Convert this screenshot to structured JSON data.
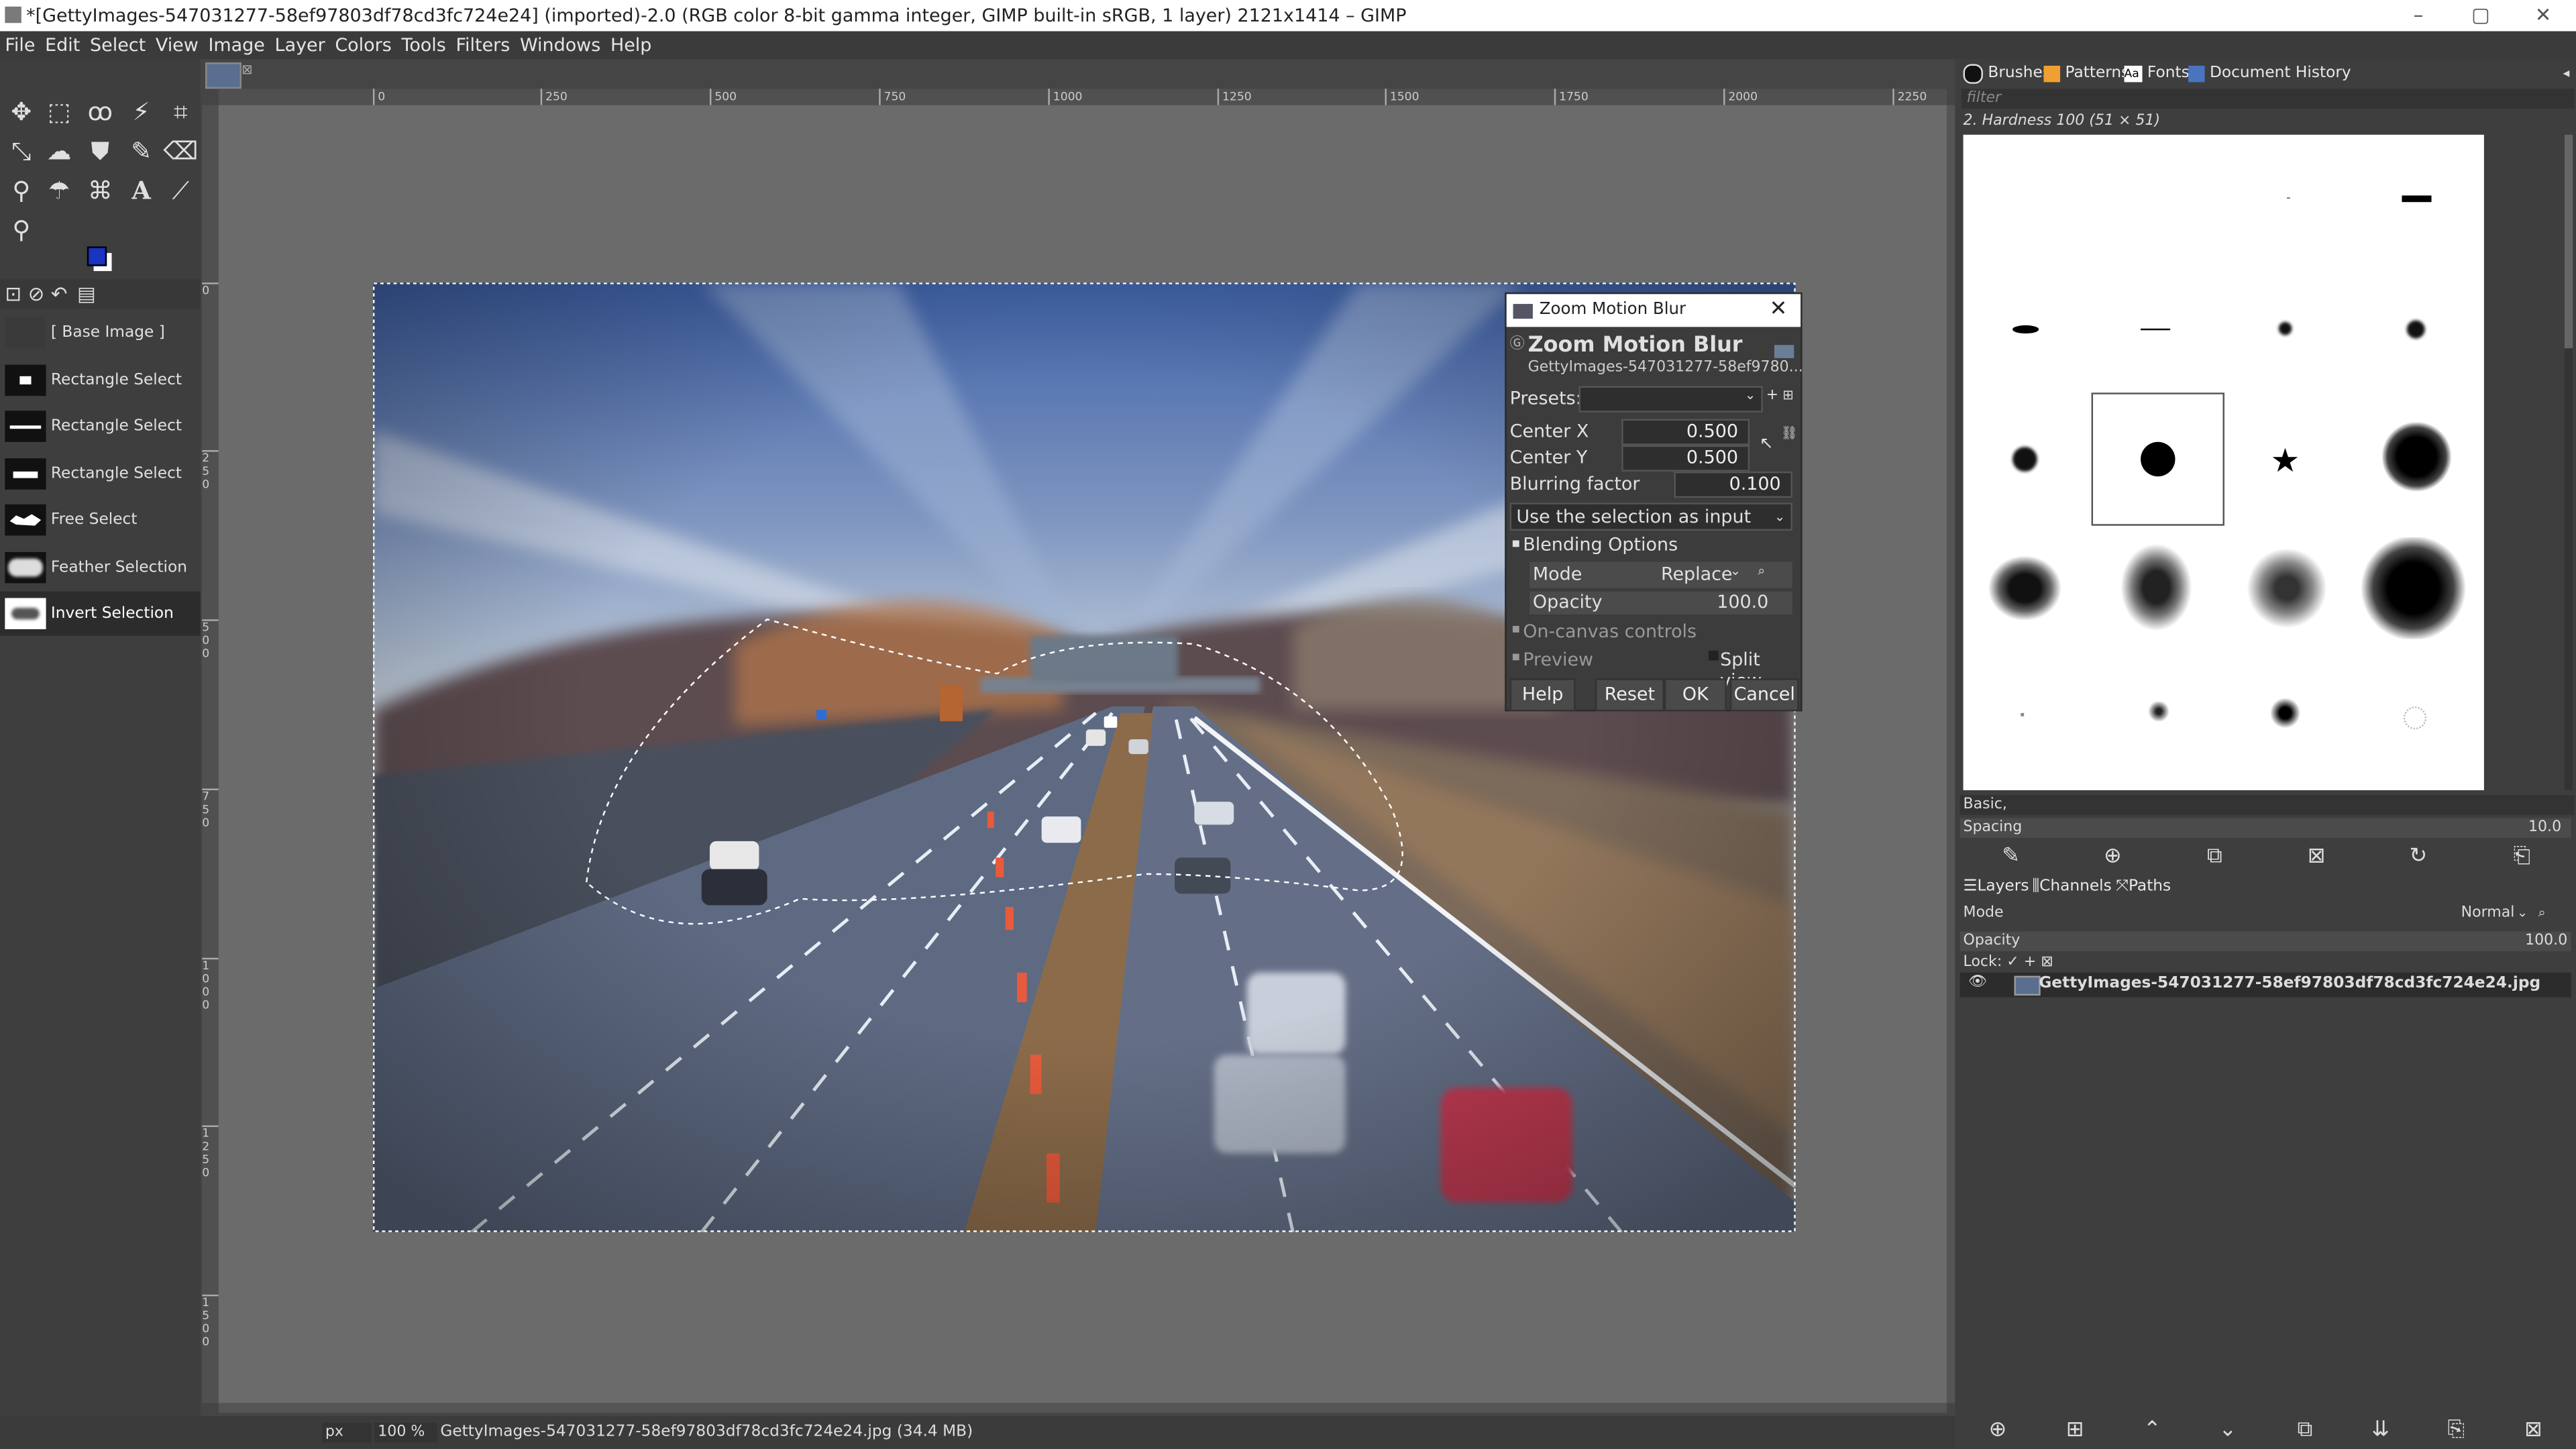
{
  "window": {
    "title": "*[GettyImages-547031277-58ef97803df78cd3fc724e24] (imported)-2.0 (RGB color 8-bit gamma integer, GIMP built-in sRGB, 1 layer) 2121x1414 – GIMP",
    "minimize": "–",
    "maximize": "▢",
    "close": "✕"
  },
  "menu": [
    "File",
    "Edit",
    "Select",
    "View",
    "Image",
    "Layer",
    "Colors",
    "Tools",
    "Filters",
    "Windows",
    "Help"
  ],
  "toolbox": {
    "tools": [
      "move-icon",
      "rect-select-icon",
      "lasso-icon",
      "fuzzy-select-icon",
      "crop-icon",
      "unified-transform-icon",
      "warp-icon",
      "bucket-fill-icon",
      "paintbrush-icon",
      "eraser-icon",
      "clone-icon",
      "smudge-icon",
      "paths-icon",
      "text-icon",
      "color-picker-icon",
      "zoom-icon"
    ]
  },
  "undo_history": {
    "items": [
      {
        "label": "[ Base Image ]"
      },
      {
        "label": "Rectangle Select"
      },
      {
        "label": "Rectangle Select"
      },
      {
        "label": "Rectangle Select"
      },
      {
        "label": "Free Select"
      },
      {
        "label": "Feather Selection"
      },
      {
        "label": "Invert Selection"
      }
    ],
    "selected_index": 6
  },
  "ruler": {
    "h_ticks": [
      "0",
      "250",
      "500",
      "750",
      "1000",
      "1250",
      "1500",
      "1750",
      "2000",
      "2250"
    ],
    "v_ticks": [
      "0",
      "250",
      "500",
      "750",
      "1000",
      "1250",
      "1500"
    ]
  },
  "dialog": {
    "window_title": "Zoom Motion Blur",
    "heading": "Zoom Motion Blur",
    "subtitle": "GettyImages-547031277-58ef9780...",
    "presets_label": "Presets:",
    "center_x_label": "Center X",
    "center_x_value": "0.500",
    "center_y_label": "Center Y",
    "center_y_value": "0.500",
    "blur_label": "Blurring factor",
    "blur_value": "0.100",
    "input_select": "Use the selection as input",
    "blending_label": "Blending Options",
    "mode_label": "Mode",
    "mode_value": "Replace",
    "opacity_label": "Opacity",
    "opacity_value": "100.0",
    "on_canvas_label": "On-canvas controls",
    "preview_label": "Preview",
    "split_view_label": "Split view",
    "help_btn": "Help",
    "reset_btn": "Reset",
    "ok_btn": "OK",
    "cancel_btn": "Cancel"
  },
  "right_dock": {
    "tabs": [
      "Brushes",
      "Patterns",
      "Fonts",
      "Document History"
    ],
    "filter_placeholder": "filter",
    "brush_info": "2. Hardness 100 (51 × 51)",
    "preset_name": "Basic,",
    "spacing_label": "Spacing",
    "spacing_value": "10.0",
    "layer_tabs": [
      "Layers",
      "Channels",
      "Paths"
    ],
    "mode_label": "Mode",
    "mode_value": "Normal",
    "opacity_label": "Opacity",
    "opacity_value": "100.0",
    "lock_label": "Lock: ✓ + ⊠",
    "layer_name": "GettyImages-547031277-58ef97803df78cd3fc724e24.jpg"
  },
  "status": {
    "unit": "px",
    "zoom": "100 %",
    "file_info": "GettyImages-547031277-58ef97803df78cd3fc724e24.jpg (34.4 MB)"
  },
  "colors": {
    "dark_bg": "#3e3e3e",
    "canvas_bg": "#6b6b6b",
    "fg_color": "#1a33c0",
    "bg_color": "#ffffff"
  }
}
